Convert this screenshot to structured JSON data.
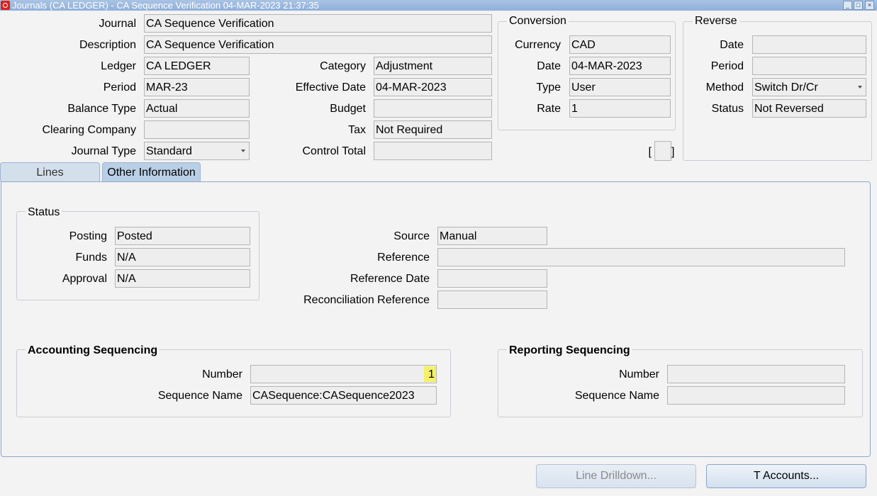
{
  "window": {
    "title": "Journals (CA LEDGER) - CA Sequence Verification 04-MAR-2023 21:37:35",
    "minimize_glyph": "_",
    "maximize_glyph": "□",
    "close_glyph": "×",
    "app_icon": "oracle-icon"
  },
  "header": {
    "journal_label": "Journal",
    "journal_value": "CA Sequence Verification",
    "description_label": "Description",
    "description_value": "CA Sequence Verification",
    "ledger_label": "Ledger",
    "ledger_value": "CA LEDGER",
    "period_label": "Period",
    "period_value": "MAR-23",
    "balance_type_label": "Balance Type",
    "balance_type_value": "Actual",
    "clearing_company_label": "Clearing Company",
    "clearing_company_value": "",
    "journal_type_label": "Journal Type",
    "journal_type_value": "Standard",
    "category_label": "Category",
    "category_value": "Adjustment",
    "effective_date_label": "Effective Date",
    "effective_date_value": "04-MAR-2023",
    "budget_label": "Budget",
    "budget_value": "",
    "tax_label": "Tax",
    "tax_value": "Not Required",
    "control_total_label": "Control Total",
    "control_total_value": ""
  },
  "conversion": {
    "title": "Conversion",
    "currency_label": "Currency",
    "currency_value": "CAD",
    "date_label": "Date",
    "date_value": "04-MAR-2023",
    "type_label": "Type",
    "type_value": "User",
    "rate_label": "Rate",
    "rate_value": "1"
  },
  "reverse": {
    "title": "Reverse",
    "date_label": "Date",
    "date_value": "",
    "period_label": "Period",
    "period_value": "",
    "method_label": "Method",
    "method_value": "Switch Dr/Cr",
    "status_label": "Status",
    "status_value": "Not Reversed"
  },
  "flex": {
    "open": "[",
    "close": "]"
  },
  "tabs": [
    {
      "label": "Lines",
      "active": false
    },
    {
      "label": "Other Information",
      "active": true
    }
  ],
  "status_group": {
    "title": "Status",
    "posting_label": "Posting",
    "posting_value": "Posted",
    "funds_label": "Funds",
    "funds_value": "N/A",
    "approval_label": "Approval",
    "approval_value": "N/A"
  },
  "other": {
    "source_label": "Source",
    "source_value": "Manual",
    "reference_label": "Reference",
    "reference_value": "",
    "reference_date_label": "Reference Date",
    "reference_date_value": "",
    "reconciliation_reference_label": "Reconciliation Reference",
    "reconciliation_reference_value": ""
  },
  "accounting_sequencing": {
    "title": "Accounting Sequencing",
    "number_label": "Number",
    "number_value": "1",
    "sequence_name_label": "Sequence Name",
    "sequence_name_value": "CASequence:CASequence2023"
  },
  "reporting_sequencing": {
    "title": "Reporting Sequencing",
    "number_label": "Number",
    "number_value": "",
    "sequence_name_label": "Sequence Name",
    "sequence_name_value": ""
  },
  "buttons": {
    "line_drilldown": {
      "label": "Line Drilldown...",
      "enabled": false
    },
    "t_accounts": {
      "label": "T Accounts...",
      "enabled": true
    }
  },
  "colors": {
    "highlight": "#f4f06a",
    "titlebar": "#8fb0da",
    "active_tab": "#b9cfe6"
  }
}
